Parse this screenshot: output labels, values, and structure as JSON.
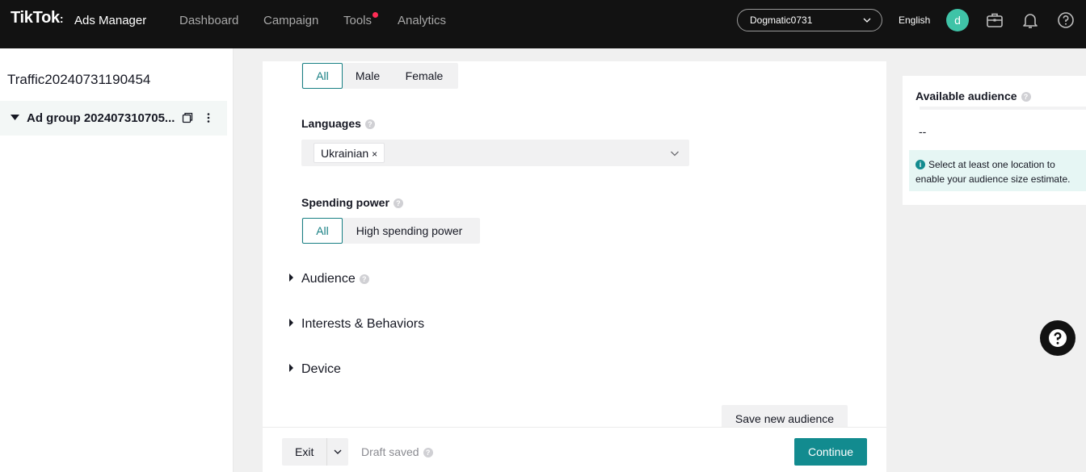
{
  "header": {
    "logo": "TikTok",
    "logo_sub": "Ads Manager",
    "nav": [
      "Dashboard",
      "Campaign",
      "Tools",
      "Analytics"
    ],
    "account": "Dogmatic0731",
    "language": "English",
    "avatar_initial": "d"
  },
  "sidebar": {
    "campaign_name": "Traffic20240731190454",
    "adgroup_label": "Ad group 202407310705..."
  },
  "form": {
    "gender": {
      "options": [
        "All",
        "Male",
        "Female"
      ],
      "selected": "All"
    },
    "languages": {
      "label": "Languages",
      "selected": [
        "Ukrainian"
      ],
      "remove_glyph": "×"
    },
    "spending_power": {
      "label": "Spending power",
      "options": [
        "All",
        "High spending power"
      ],
      "selected": "All"
    },
    "sections": [
      "Audience",
      "Interests & Behaviors",
      "Device"
    ],
    "save_audience": "Save new audience"
  },
  "footer": {
    "exit": "Exit",
    "draft_status": "Draft saved",
    "continue": "Continue"
  },
  "audience_panel": {
    "title": "Available audience",
    "value": "--",
    "info": "Select at least one location to enable your audience size estimate."
  },
  "colors": {
    "accent": "#128b8f",
    "notification_dot": "#fe2c55",
    "avatar": "#3fc3a7"
  }
}
